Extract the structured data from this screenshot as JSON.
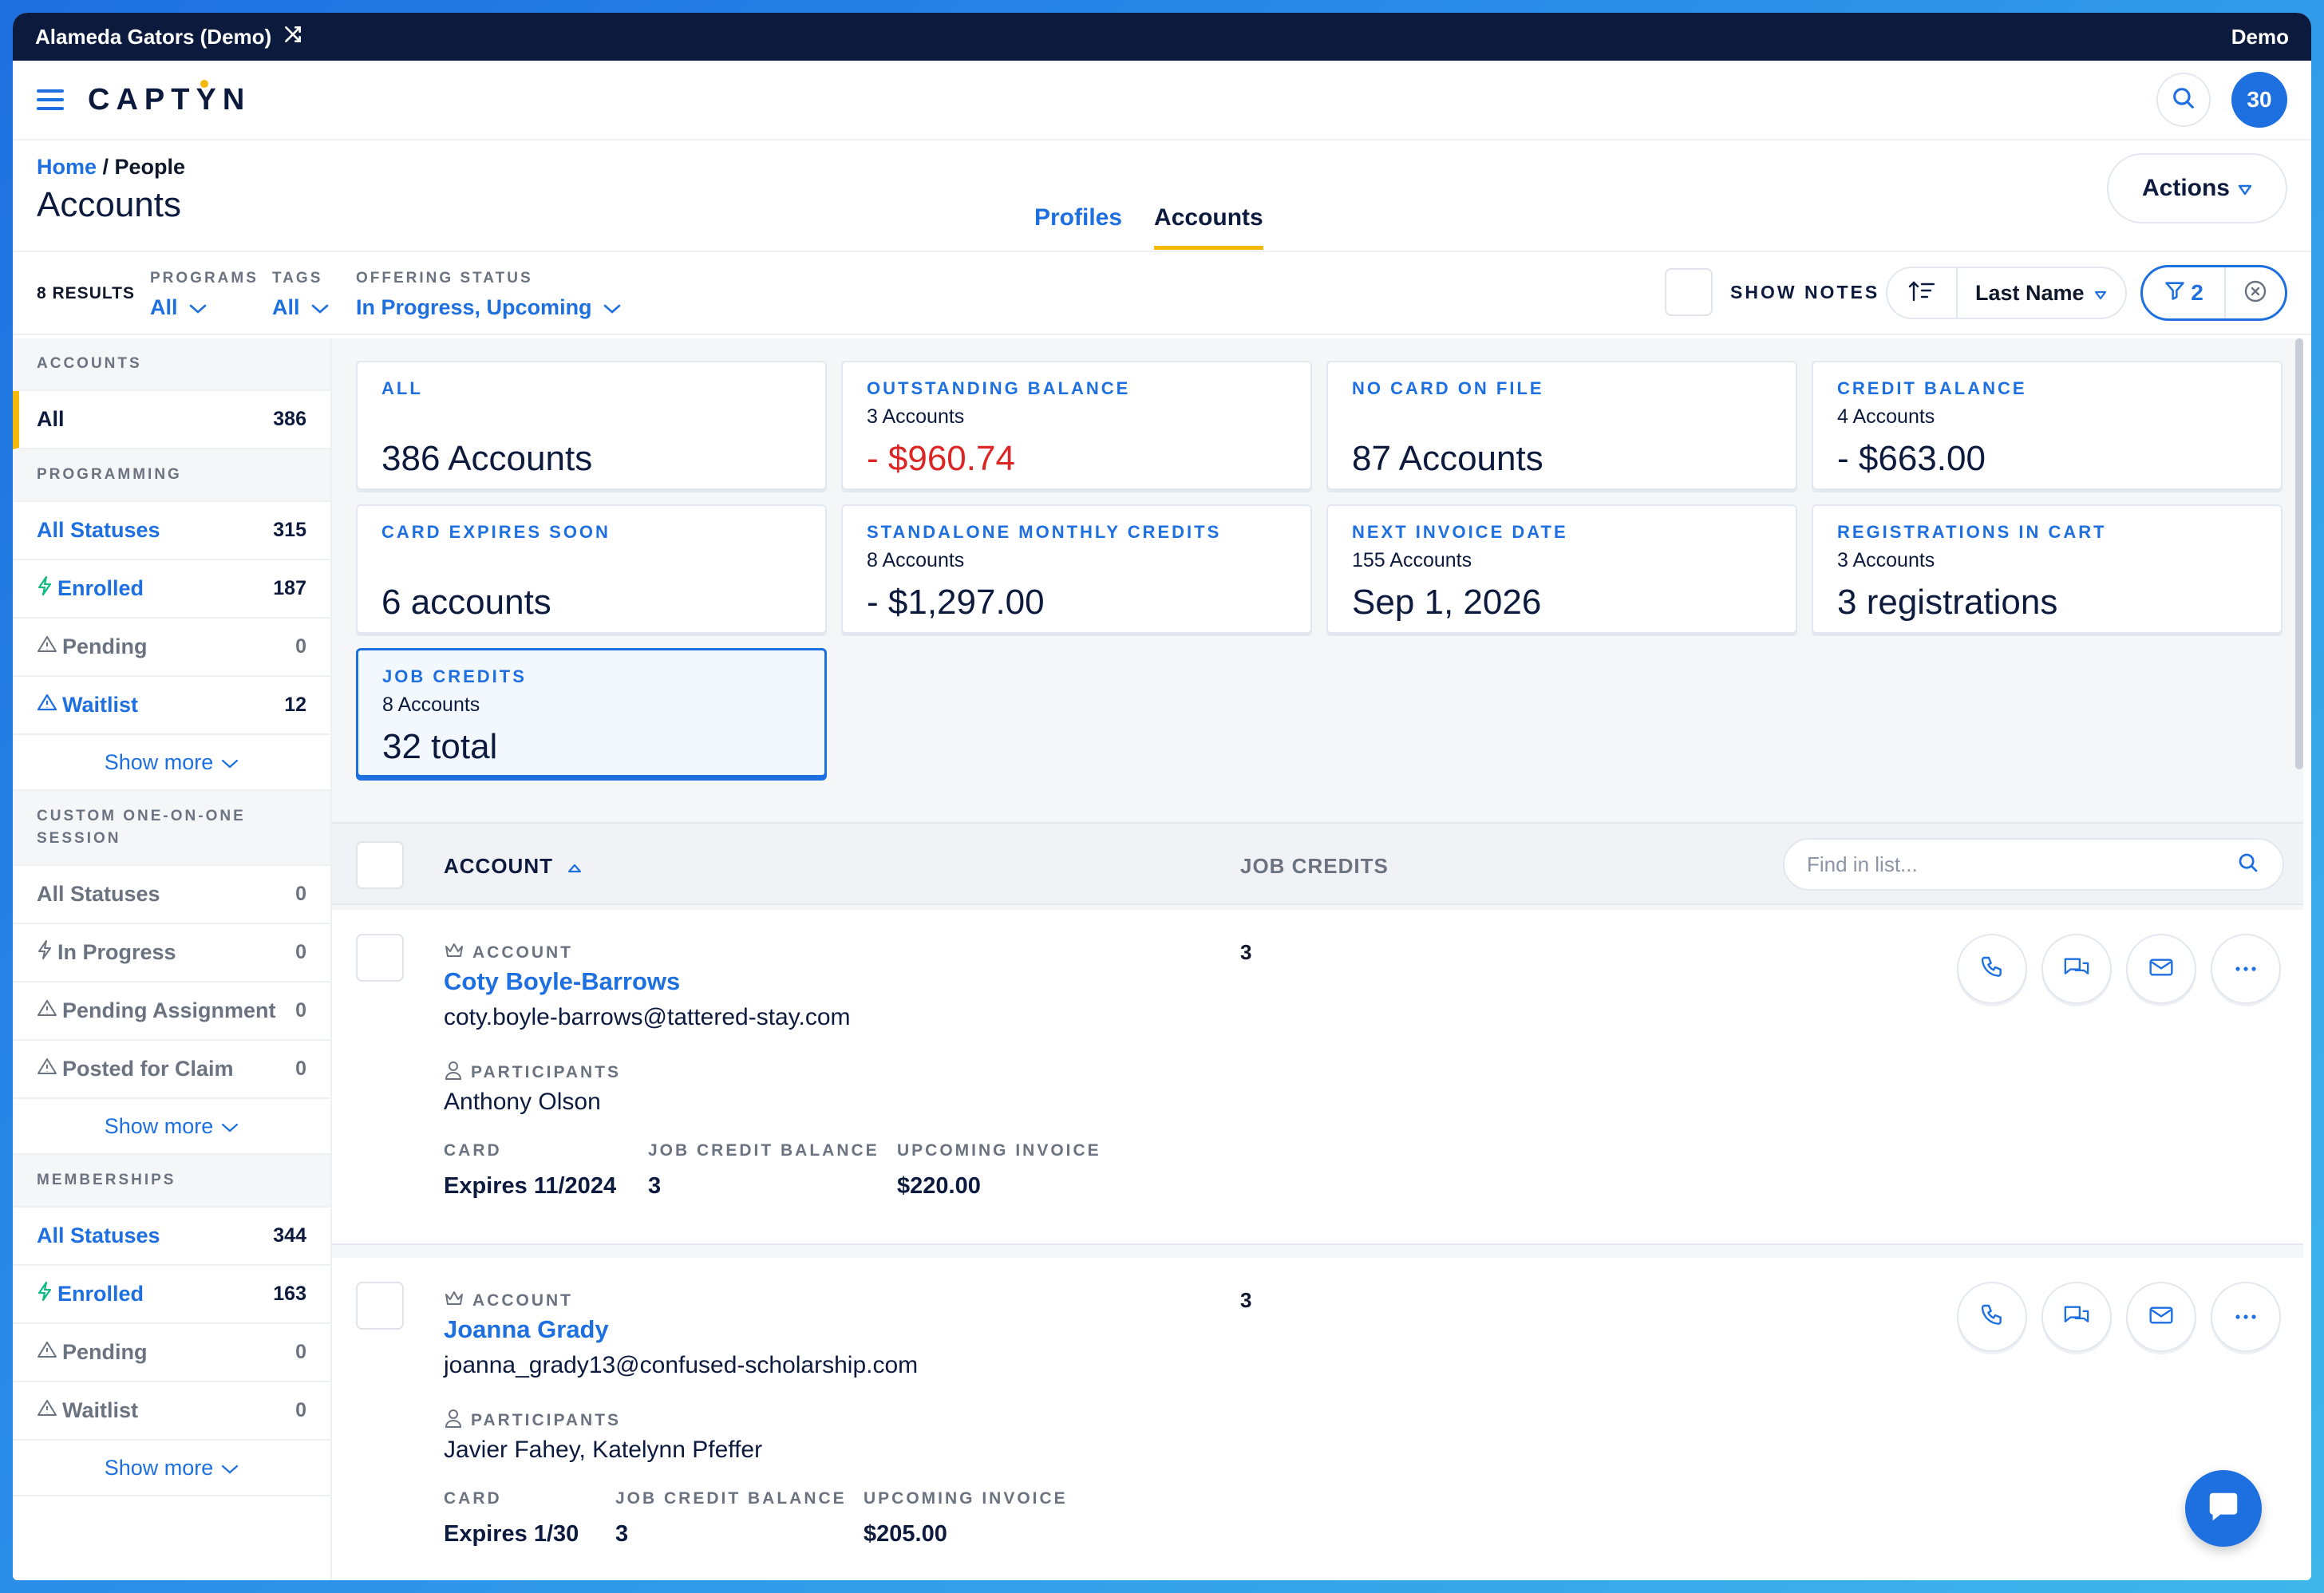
{
  "org": {
    "name": "Alameda Gators (Demo)",
    "mode": "Demo"
  },
  "header": {
    "logo": "CAPTYN",
    "notifications_count": "30"
  },
  "page": {
    "breadcrumb_home": "Home",
    "breadcrumb_sep": " / ",
    "breadcrumb_current": "People",
    "title": "Accounts",
    "tabs": [
      {
        "label": "Profiles"
      },
      {
        "label": "Accounts"
      }
    ],
    "actions_label": "Actions"
  },
  "filters": {
    "results": "8 RESULTS",
    "programs": {
      "label": "PROGRAMS",
      "value": "All"
    },
    "tags": {
      "label": "TAGS",
      "value": "All"
    },
    "offering_status": {
      "label": "OFFERING STATUS",
      "value": "In Progress, Upcoming"
    },
    "show_notes": "SHOW NOTES",
    "sort": "Last Name",
    "filter_count": "2"
  },
  "sidebar": {
    "accounts": {
      "heading": "ACCOUNTS",
      "items": [
        {
          "label": "All",
          "count": "386"
        }
      ]
    },
    "programming": {
      "heading": "PROGRAMMING",
      "items": [
        {
          "label": "All Statuses",
          "count": "315"
        },
        {
          "label": "Enrolled",
          "count": "187"
        },
        {
          "label": "Pending",
          "count": "0"
        },
        {
          "label": "Waitlist",
          "count": "12"
        }
      ],
      "show_more": "Show more"
    },
    "custom": {
      "heading": "CUSTOM ONE-ON-ONE SESSION",
      "items": [
        {
          "label": "All Statuses",
          "count": "0"
        },
        {
          "label": "In Progress",
          "count": "0"
        },
        {
          "label": "Pending Assignment",
          "count": "0"
        },
        {
          "label": "Posted for Claim",
          "count": "0"
        }
      ],
      "show_more": "Show more"
    },
    "memberships": {
      "heading": "MEMBERSHIPS",
      "items": [
        {
          "label": "All Statuses",
          "count": "344"
        },
        {
          "label": "Enrolled",
          "count": "163"
        },
        {
          "label": "Pending",
          "count": "0"
        },
        {
          "label": "Waitlist",
          "count": "0"
        }
      ],
      "show_more": "Show more"
    }
  },
  "cards": [
    {
      "title": "ALL",
      "sub": "",
      "value": "386 Accounts"
    },
    {
      "title": "OUTSTANDING BALANCE",
      "sub": "3 Accounts",
      "value_sign": "- ",
      "value": "$960.74"
    },
    {
      "title": "NO CARD ON FILE",
      "sub": "",
      "value": "87 Accounts"
    },
    {
      "title": "CREDIT BALANCE",
      "sub": "4 Accounts",
      "value": "- $663.00"
    },
    {
      "title": "CARD EXPIRES SOON",
      "sub": "",
      "value": "6 accounts"
    },
    {
      "title": "STANDALONE MONTHLY CREDITS",
      "sub": "8 Accounts",
      "value": "- $1,297.00"
    },
    {
      "title": "NEXT INVOICE DATE",
      "sub": "155 Accounts",
      "value": "Sep 1, 2026"
    },
    {
      "title": "REGISTRATIONS IN CART",
      "sub": "3 Accounts",
      "value": "3 registrations"
    },
    {
      "title": "JOB CREDITS",
      "sub": "8 Accounts",
      "value": "32 total"
    }
  ],
  "list": {
    "col_account": "ACCOUNT",
    "col_job_credits": "JOB CREDITS",
    "find_placeholder": "Find in list...",
    "rows": [
      {
        "kicker": "ACCOUNT",
        "name": "Coty Boyle-Barrows",
        "email": "coty.boyle-barrows@tattered-stay.com",
        "participants_label": "PARTICIPANTS",
        "participants": "Anthony Olson",
        "card_label": "CARD",
        "card": "Expires 11/2024",
        "jcb_label": "JOB CREDIT BALANCE",
        "jcb": "3",
        "inv_label": "UPCOMING INVOICE",
        "inv": "$220.00",
        "job_credits": "3"
      },
      {
        "kicker": "ACCOUNT",
        "name": "Joanna Grady",
        "email": "joanna_grady13@confused-scholarship.com",
        "participants_label": "PARTICIPANTS",
        "participants": "Javier Fahey, Katelynn Pfeffer",
        "card_label": "CARD",
        "card": "Expires 1/30",
        "jcb_label": "JOB CREDIT BALANCE",
        "jcb": "3",
        "inv_label": "UPCOMING INVOICE",
        "inv": "$205.00",
        "job_credits": "3"
      }
    ]
  },
  "colors": {
    "brand": "#1e6fe0",
    "accent": "#f5b70a",
    "navy": "#0c1a3e",
    "danger": "#dc2626"
  }
}
